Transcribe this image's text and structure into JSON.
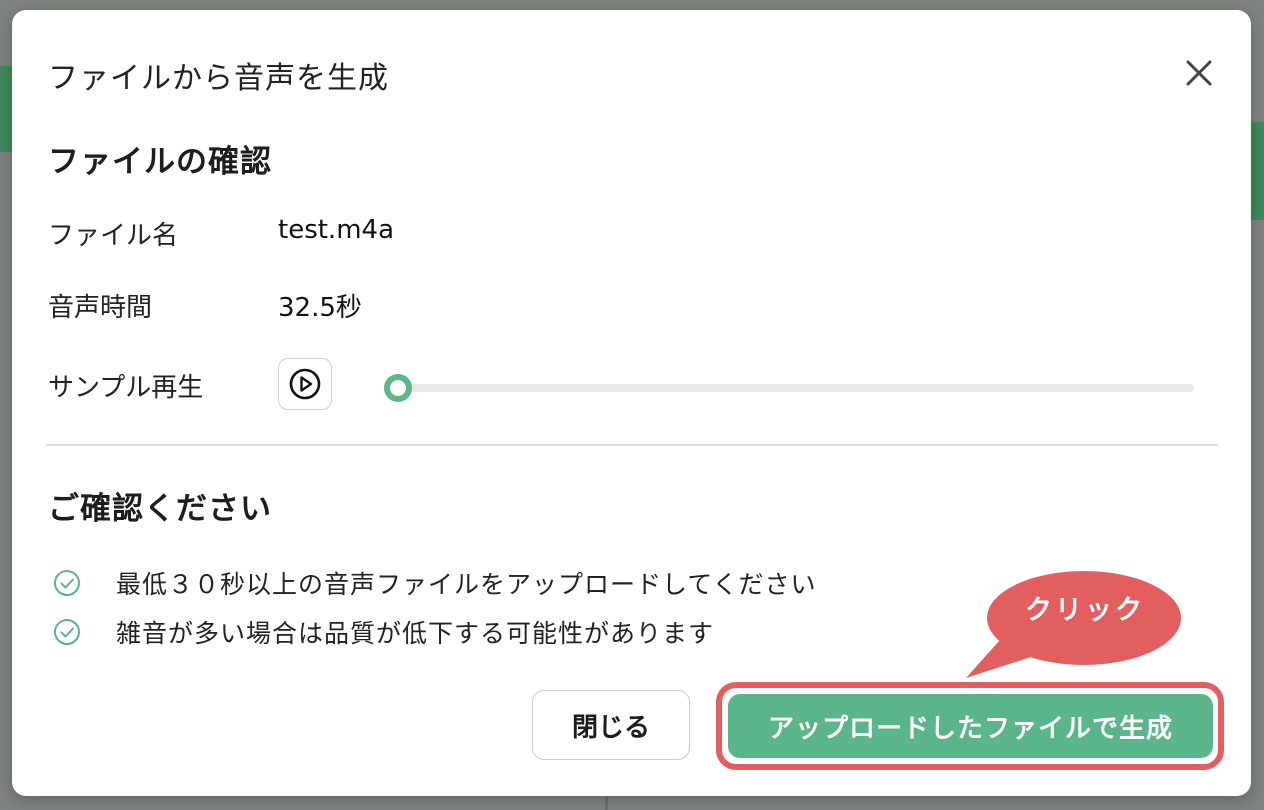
{
  "dialog": {
    "title": "ファイルから音声を生成",
    "close_icon": "close-icon"
  },
  "file_check": {
    "heading": "ファイルの確認",
    "file_name_label": "ファイル名",
    "file_name_value": "test.m4a",
    "duration_label": "音声時間",
    "duration_value": "32.5秒",
    "sample_label": "サンプル再生",
    "play_icon": "play-circle-icon",
    "playback_progress": 0
  },
  "notices": {
    "heading": "ご確認ください",
    "items": [
      {
        "icon": "check-circle-icon",
        "text": "最低３０秒以上の音声ファイルをアップロードしてください"
      },
      {
        "icon": "check-circle-icon",
        "text": "雑音が多い場合は品質が低下する可能性があります"
      }
    ]
  },
  "footer": {
    "close_label": "閉じる",
    "generate_label": "アップロードしたファイルで生成"
  },
  "annotation": {
    "callout_text": "クリック"
  },
  "colors": {
    "accent_green": "#5bb58a",
    "highlight_red": "#e35f5f"
  }
}
